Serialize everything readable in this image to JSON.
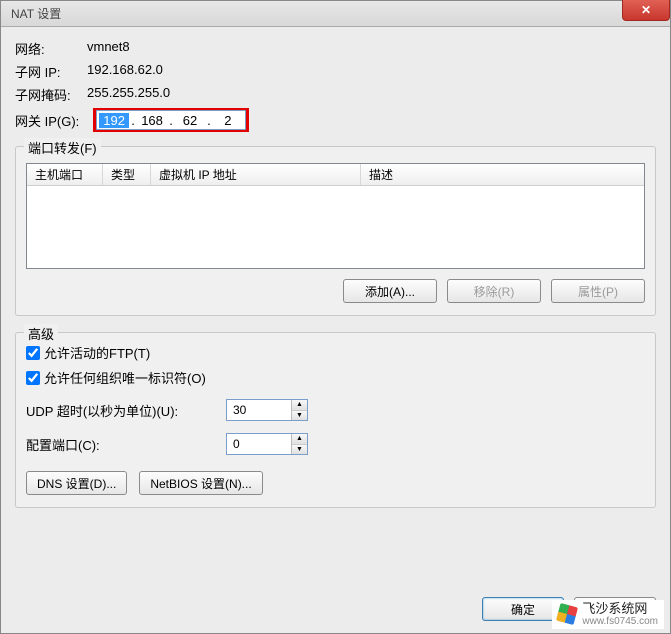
{
  "window": {
    "title": "NAT 设置",
    "close_glyph": "✕"
  },
  "info": {
    "network_label": "网络:",
    "network_value": "vmnet8",
    "subnet_ip_label": "子网 IP:",
    "subnet_ip_value": "192.168.62.0",
    "subnet_mask_label": "子网掩码:",
    "subnet_mask_value": "255.255.255.0",
    "gateway_label": "网关 IP(G):",
    "gateway_ip": {
      "o1": "192",
      "o2": "168",
      "o3": "62",
      "o4": "2"
    }
  },
  "port_forward": {
    "legend": "端口转发(F)",
    "columns": {
      "host_port": "主机端口",
      "type": "类型",
      "vm_ip": "虚拟机 IP 地址",
      "desc": "描述"
    },
    "buttons": {
      "add": "添加(A)...",
      "remove": "移除(R)",
      "properties": "属性(P)"
    }
  },
  "advanced": {
    "legend": "高级",
    "allow_ftp": "允许活动的FTP(T)",
    "allow_oui": "允许任何组织唯一标识符(O)",
    "udp_timeout_label": "UDP 超时(以秒为单位)(U):",
    "udp_timeout_value": "30",
    "config_port_label": "配置端口(C):",
    "config_port_value": "0",
    "dns_btn": "DNS 设置(D)...",
    "netbios_btn": "NetBIOS 设置(N)..."
  },
  "footer": {
    "ok": "确定",
    "cancel": "取消"
  },
  "watermark": {
    "name": "飞沙系统网",
    "url": "www.fs0745.com"
  }
}
